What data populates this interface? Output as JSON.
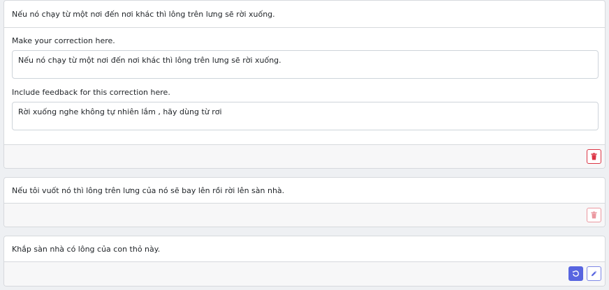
{
  "corrections": [
    {
      "sentence": "Nếu nó chạy từ một nơi đến nơi khác thì lông trên lưng sẽ rời xuống.",
      "correction_label": "Make your correction here.",
      "correction_value": "Nếu nó chạy từ một nơi đến nơi khác thì lông trên lưng sẽ rời xuống.",
      "feedback_label": "Include feedback for this correction here.",
      "feedback_value": "Rời xuống nghe không tự nhiên lắm , hãy dùng từ rơi",
      "actions": [
        "trash-icon"
      ]
    },
    {
      "sentence": "Nếu tôi vuốt nó thì lông trên lưng của nó sẽ bay lên rồi rời lên sàn nhà.",
      "actions": [
        "trash-icon"
      ]
    },
    {
      "sentence": "Khắp sàn nhà có lông của con thỏ này.",
      "actions": [
        "undo-icon",
        "pencil-icon"
      ]
    }
  ],
  "colors": {
    "danger": "#dc3545",
    "primary": "#5865e0",
    "border": "#d6d9dd",
    "page_background": "#eef0f3"
  }
}
